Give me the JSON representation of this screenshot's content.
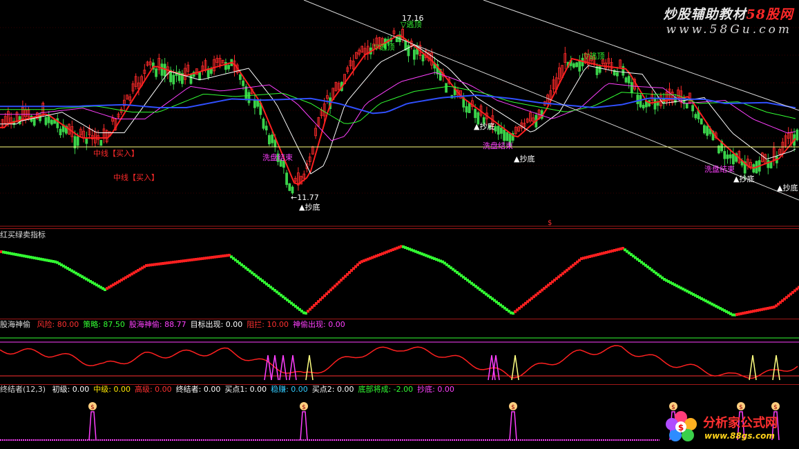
{
  "watermark": {
    "site_cn": "炒股辅助教材",
    "site_num": "58股网",
    "url": "www.58Gu.com"
  },
  "logo": {
    "name": "分析家公式网",
    "url": "www.88gs.com"
  },
  "main_chart": {
    "price_high_label": "17.16",
    "price_low_label": "←11.77",
    "annotations": {
      "top1": "▽逃顶",
      "top2": "▽逃顶",
      "top3": "▽逃顶",
      "mid_buy1": "中线【买入】",
      "mid_buy2": "中线【买入】",
      "wash1": "洗盘结束",
      "wash2": "洗盘结束",
      "wash3": "洗盘结束",
      "bottom1": "▲抄底",
      "bottom2": "▲抄底",
      "bottom3": "▲抄底",
      "bottom4": "▲抄底",
      "bottom5": "▲抄底",
      "bottom6": "▲抄底"
    },
    "marker": "$"
  },
  "indicator1": {
    "title": "红买绿卖指标"
  },
  "indicator2": {
    "name": "股海神偷",
    "fields": [
      {
        "label": "风险:",
        "value": "80.00",
        "color": "#ff3030"
      },
      {
        "label": "策略:",
        "value": "87.50",
        "color": "#33ff33"
      },
      {
        "label": "股海神偷:",
        "value": "88.77",
        "color": "#ff40ff"
      },
      {
        "label": "目标出现:",
        "value": "0.00",
        "color": "#ffffff"
      },
      {
        "label": "阻拦:",
        "value": "10.00",
        "color": "#ff3030"
      },
      {
        "label": "神偷出现:",
        "value": "0.00",
        "color": "#ff40ff"
      }
    ]
  },
  "indicator3": {
    "name": "终结者(12,3)",
    "fields": [
      {
        "label": "初级:",
        "value": "0.00",
        "color": "#ffffff"
      },
      {
        "label": "中级:",
        "value": "0.00",
        "color": "#ffe800"
      },
      {
        "label": "高级:",
        "value": "0.00",
        "color": "#ff3030"
      },
      {
        "label": "终结者:",
        "value": "0.00",
        "color": "#ffffff"
      },
      {
        "label": "买点1:",
        "value": "0.00",
        "color": "#ffffff"
      },
      {
        "label": "稳赚:",
        "value": "0.00",
        "color": "#33ccff"
      },
      {
        "label": "买点2:",
        "value": "0.00",
        "color": "#ffffff"
      },
      {
        "label": "底部将成:",
        "value": "-2.00",
        "color": "#33ff33"
      },
      {
        "label": "抄底:",
        "value": "0.00",
        "color": "#ff40ff"
      }
    ],
    "marker": "$"
  }
}
